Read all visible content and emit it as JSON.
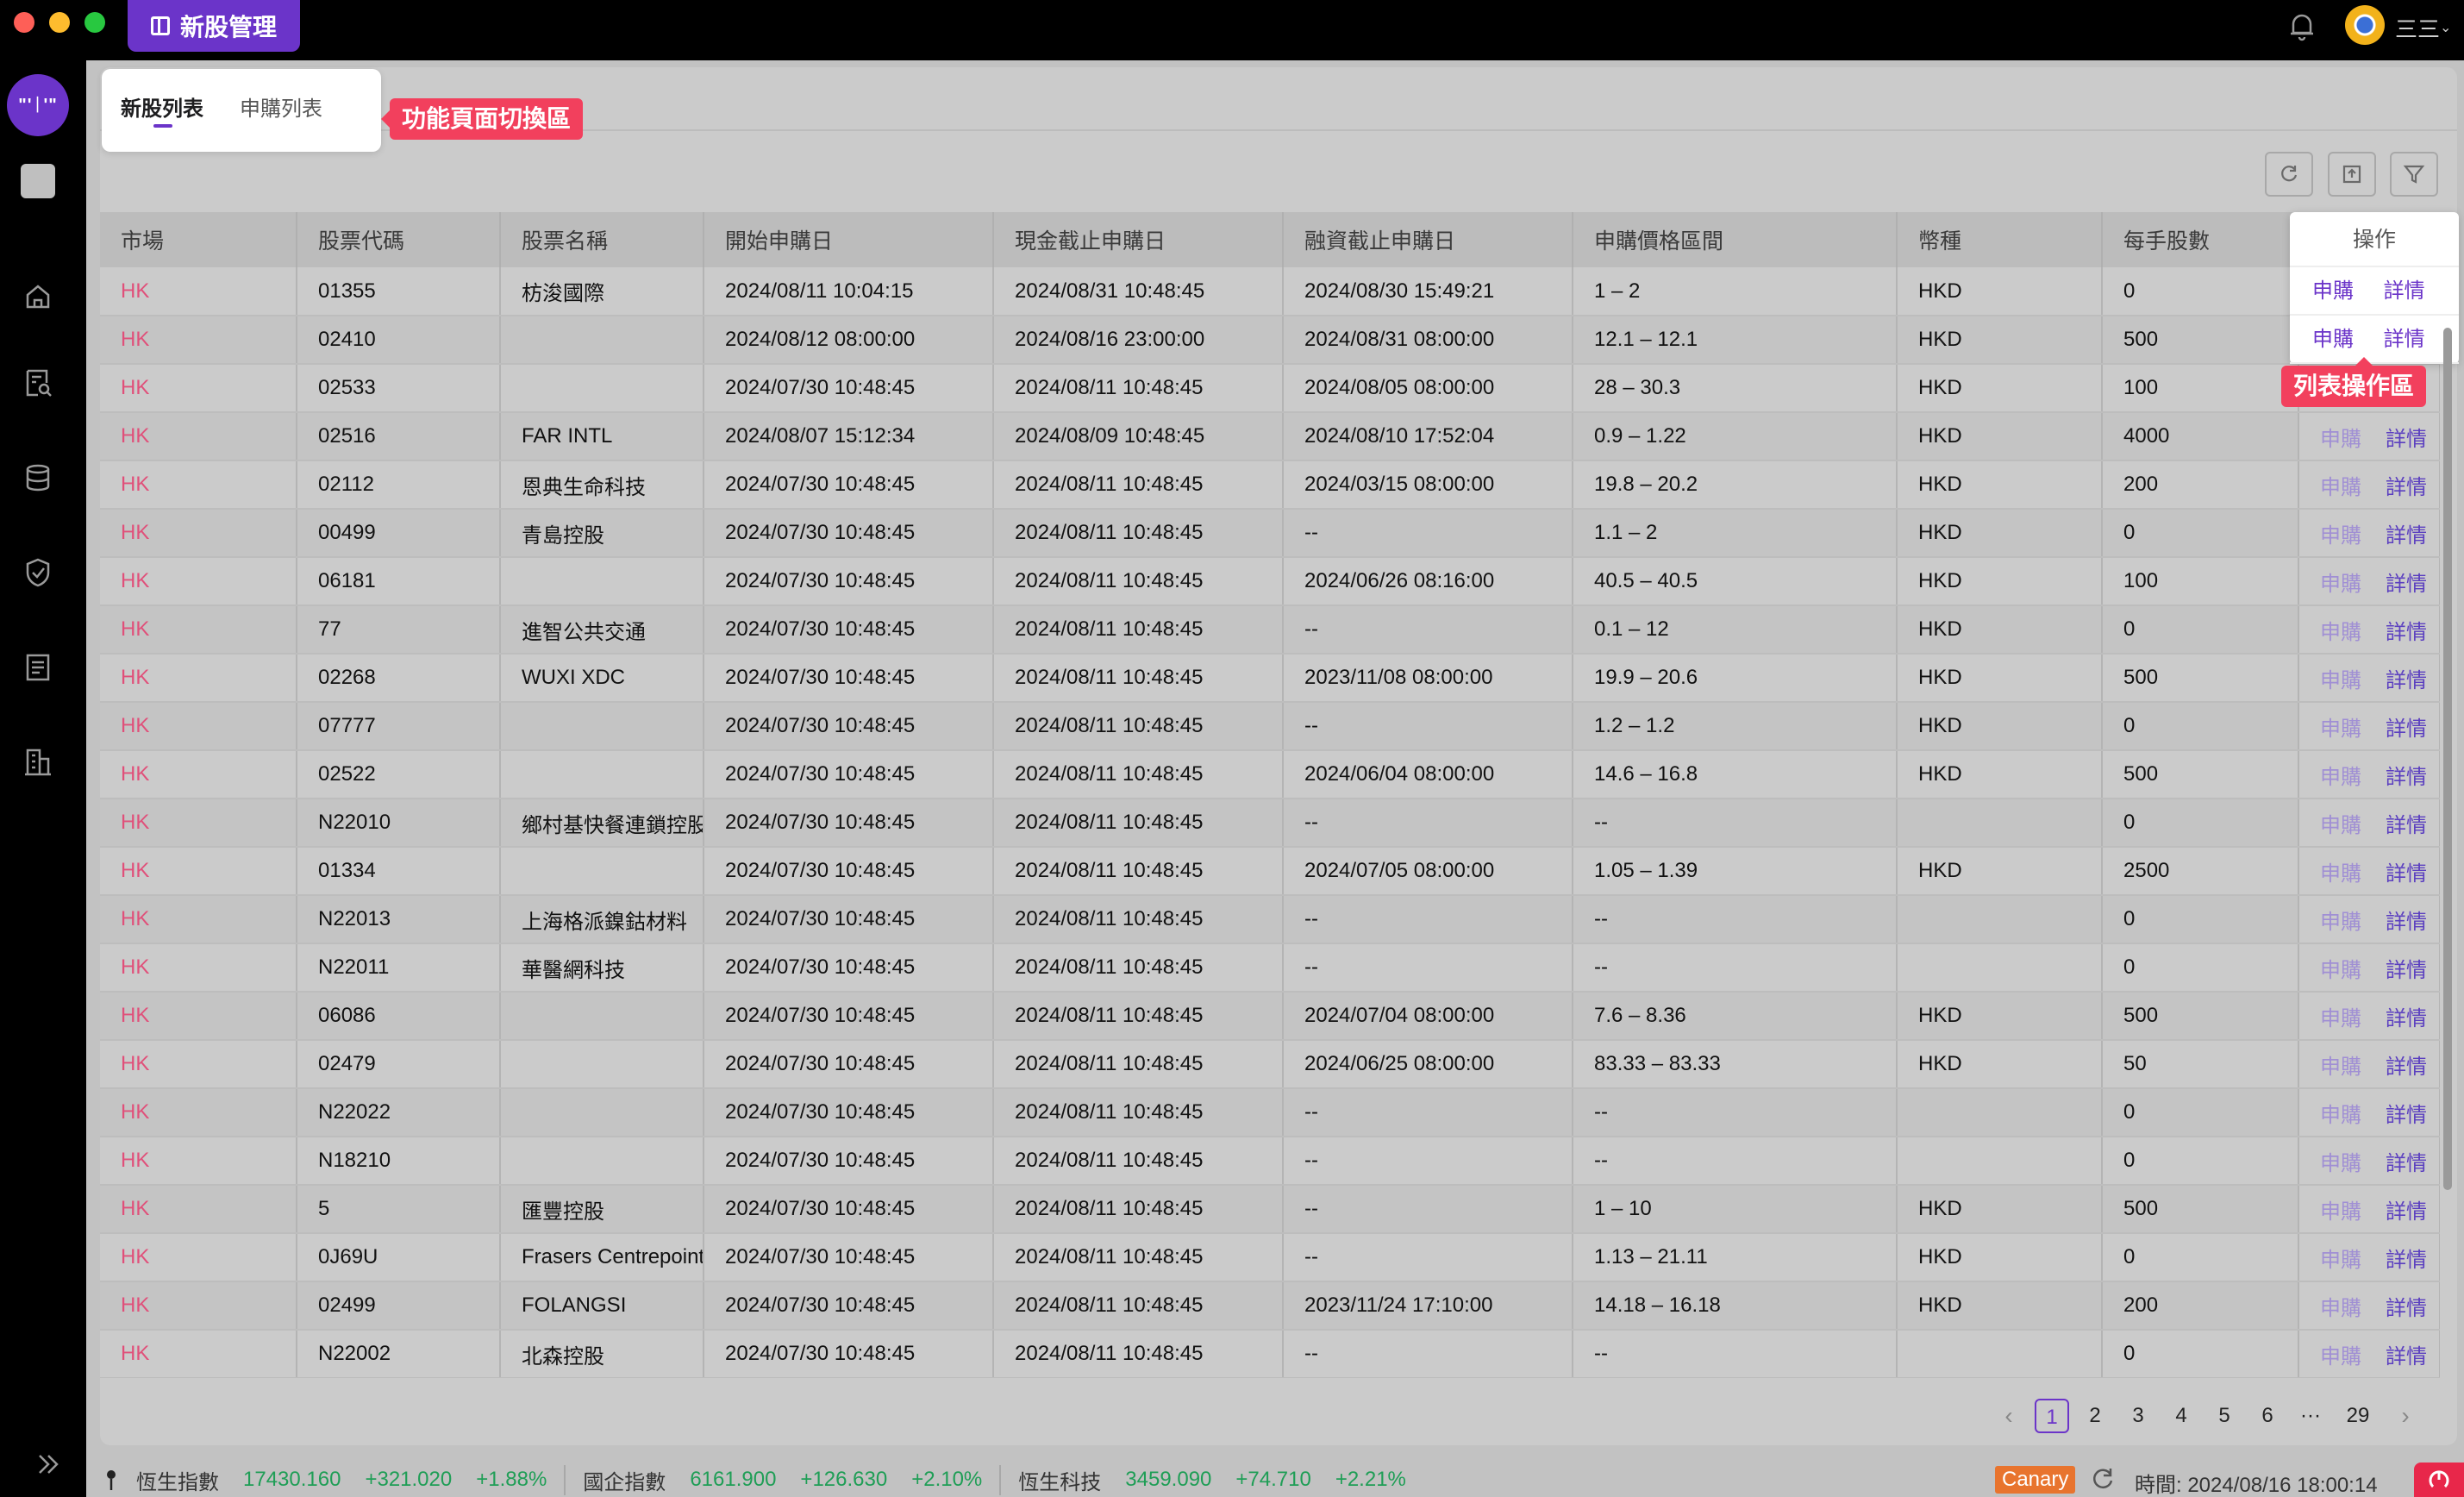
{
  "window": {
    "app_tab_label": "新股管理",
    "user_name": "三三"
  },
  "brand": {
    "logo_text": "\"'ᛁ'\""
  },
  "tabs": {
    "ipo_list": "新股列表",
    "apply_list": "申購列表"
  },
  "callouts": {
    "tabs_area": "功能頁面切換區",
    "ops_area": "列表操作區"
  },
  "table": {
    "columns": [
      "市場",
      "股票代碼",
      "股票名稱",
      "開始申購日",
      "現金截止申購日",
      "融資截止申購日",
      "申購價格區間",
      "幣種",
      "每手股數",
      "操作"
    ],
    "op_apply": "申購",
    "op_detail": "詳情",
    "rows": [
      [
        "HK",
        "01355",
        "枋浚國際",
        "2024/08/11 10:04:15",
        "2024/08/31 10:48:45",
        "2024/08/30 15:49:21",
        "1 – 2",
        "HKD",
        "0"
      ],
      [
        "HK",
        "02410",
        "",
        "2024/08/12 08:00:00",
        "2024/08/16 23:00:00",
        "2024/08/31 08:00:00",
        "12.1 – 12.1",
        "HKD",
        "500"
      ],
      [
        "HK",
        "02533",
        "",
        "2024/07/30 10:48:45",
        "2024/08/11 10:48:45",
        "2024/08/05 08:00:00",
        "28 – 30.3",
        "HKD",
        "100"
      ],
      [
        "HK",
        "02516",
        "FAR INTL",
        "2024/08/07 15:12:34",
        "2024/08/09 10:48:45",
        "2024/08/10 17:52:04",
        "0.9 – 1.22",
        "HKD",
        "4000"
      ],
      [
        "HK",
        "02112",
        "恩典生命科技",
        "2024/07/30 10:48:45",
        "2024/08/11 10:48:45",
        "2024/03/15 08:00:00",
        "19.8 – 20.2",
        "HKD",
        "200"
      ],
      [
        "HK",
        "00499",
        "青島控股",
        "2024/07/30 10:48:45",
        "2024/08/11 10:48:45",
        "--",
        "1.1 – 2",
        "HKD",
        "0"
      ],
      [
        "HK",
        "06181",
        "",
        "2024/07/30 10:48:45",
        "2024/08/11 10:48:45",
        "2024/06/26 08:16:00",
        "40.5 – 40.5",
        "HKD",
        "100"
      ],
      [
        "HK",
        "77",
        "進智公共交通",
        "2024/07/30 10:48:45",
        "2024/08/11 10:48:45",
        "--",
        "0.1 – 12",
        "HKD",
        "0"
      ],
      [
        "HK",
        "02268",
        "WUXI XDC",
        "2024/07/30 10:48:45",
        "2024/08/11 10:48:45",
        "2023/11/08 08:00:00",
        "19.9 – 20.6",
        "HKD",
        "500"
      ],
      [
        "HK",
        "07777",
        "",
        "2024/07/30 10:48:45",
        "2024/08/11 10:48:45",
        "--",
        "1.2 – 1.2",
        "HKD",
        "0"
      ],
      [
        "HK",
        "02522",
        "",
        "2024/07/30 10:48:45",
        "2024/08/11 10:48:45",
        "2024/06/04 08:00:00",
        "14.6 – 16.8",
        "HKD",
        "500"
      ],
      [
        "HK",
        "N22010",
        "鄉村基快餐連鎖控股",
        "2024/07/30 10:48:45",
        "2024/08/11 10:48:45",
        "--",
        "--",
        "",
        "0"
      ],
      [
        "HK",
        "01334",
        "",
        "2024/07/30 10:48:45",
        "2024/08/11 10:48:45",
        "2024/07/05 08:00:00",
        "1.05 – 1.39",
        "HKD",
        "2500"
      ],
      [
        "HK",
        "N22013",
        "上海格派鎳鈷材料",
        "2024/07/30 10:48:45",
        "2024/08/11 10:48:45",
        "--",
        "--",
        "",
        "0"
      ],
      [
        "HK",
        "N22011",
        "華醫網科技",
        "2024/07/30 10:48:45",
        "2024/08/11 10:48:45",
        "--",
        "--",
        "",
        "0"
      ],
      [
        "HK",
        "06086",
        "",
        "2024/07/30 10:48:45",
        "2024/08/11 10:48:45",
        "2024/07/04 08:00:00",
        "7.6 – 8.36",
        "HKD",
        "500"
      ],
      [
        "HK",
        "02479",
        "",
        "2024/07/30 10:48:45",
        "2024/08/11 10:48:45",
        "2024/06/25 08:00:00",
        "83.33 – 83.33",
        "HKD",
        "50"
      ],
      [
        "HK",
        "N22022",
        "",
        "2024/07/30 10:48:45",
        "2024/08/11 10:48:45",
        "--",
        "--",
        "",
        "0"
      ],
      [
        "HK",
        "N18210",
        "",
        "2024/07/30 10:48:45",
        "2024/08/11 10:48:45",
        "--",
        "--",
        "",
        "0"
      ],
      [
        "HK",
        "5",
        "匯豐控股",
        "2024/07/30 10:48:45",
        "2024/08/11 10:48:45",
        "--",
        "1 – 10",
        "HKD",
        "500"
      ],
      [
        "HK",
        "0J69U",
        "Frasers Centrepoint",
        "2024/07/30 10:48:45",
        "2024/08/11 10:48:45",
        "--",
        "1.13 – 21.11",
        "HKD",
        "0"
      ],
      [
        "HK",
        "02499",
        "FOLANGSI",
        "2024/07/30 10:48:45",
        "2024/08/11 10:48:45",
        "2023/11/24 17:10:00",
        "14.18 – 16.18",
        "HKD",
        "200"
      ],
      [
        "HK",
        "N22002",
        "北森控股",
        "2024/07/30 10:48:45",
        "2024/08/11 10:48:45",
        "--",
        "--",
        "",
        "0"
      ]
    ]
  },
  "pagination": {
    "pages": [
      "1",
      "2",
      "3",
      "4",
      "5",
      "6"
    ],
    "current": "1",
    "ellipsis": "···",
    "last": "29"
  },
  "statusbar": {
    "indices": [
      {
        "name": "恆生指數",
        "value": "17430.160",
        "change": "+321.020",
        "pct": "+1.88%"
      },
      {
        "name": "國企指數",
        "value": "6161.900",
        "change": "+126.630",
        "pct": "+2.10%"
      },
      {
        "name": "恆生科技",
        "value": "3459.090",
        "change": "+74.710",
        "pct": "+2.21%"
      }
    ],
    "env_badge": "Canary",
    "clock": "時間: 2024/08/16 18:00:14"
  },
  "colors": {
    "brand": "#6b34c9",
    "callout": "#f2405d",
    "market_text": "#e0507a",
    "index_up": "#1f9e56",
    "canary": "#e8742e"
  },
  "icons": [
    "bell-icon",
    "home-icon",
    "search-doc-icon",
    "database-icon",
    "shield-check-icon",
    "settings-doc-icon",
    "building-icon",
    "collapse-icon",
    "refresh-icon",
    "export-icon",
    "filter-icon",
    "pin-icon"
  ]
}
